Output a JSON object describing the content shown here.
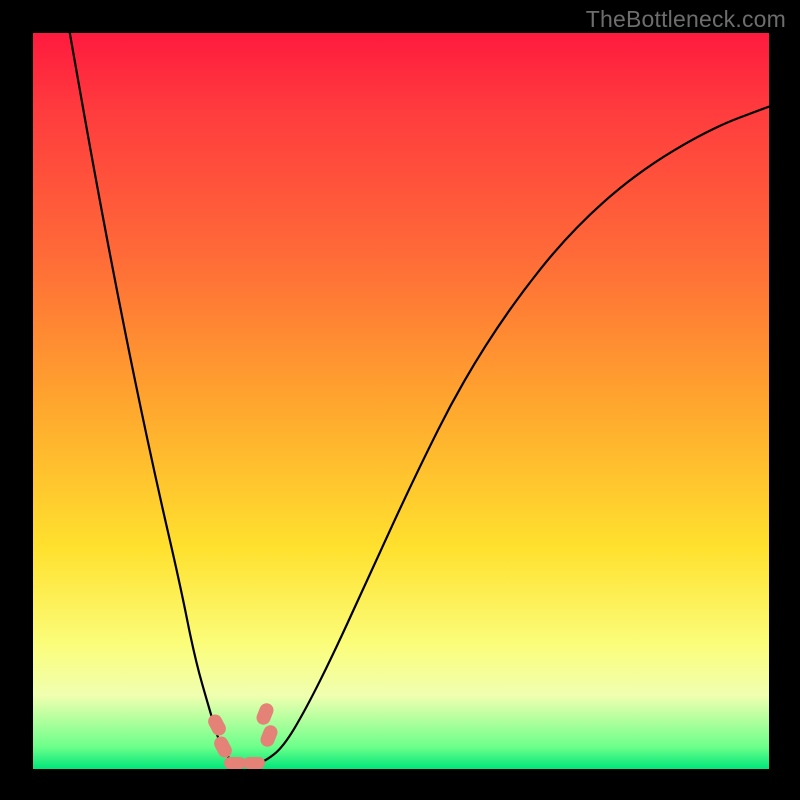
{
  "watermark": "TheBottleneck.com",
  "chart_data": {
    "type": "line",
    "title": "",
    "xlabel": "",
    "ylabel": "",
    "xlim": [
      0,
      100
    ],
    "ylim": [
      0,
      100
    ],
    "grid": false,
    "series": [
      {
        "name": "bottleneck-curve",
        "x": [
          5,
          8,
          11,
          14,
          17,
          20,
          22,
          24,
          25.5,
          27,
          28,
          29.5,
          31.5,
          34,
          37,
          41,
          46,
          52,
          58,
          65,
          73,
          82,
          92,
          100
        ],
        "y": [
          100,
          83,
          67,
          52,
          38,
          25,
          15,
          8,
          3,
          1,
          0.5,
          0.5,
          1,
          3,
          8,
          16,
          27,
          40,
          52,
          63,
          73,
          81,
          87,
          90
        ]
      }
    ],
    "annotations": [
      {
        "name": "marker-left-upper",
        "x": 25.0,
        "y": 6.0
      },
      {
        "name": "marker-left-lower",
        "x": 25.8,
        "y": 3.0
      },
      {
        "name": "marker-right-upper",
        "x": 31.5,
        "y": 7.5
      },
      {
        "name": "marker-right-lower",
        "x": 32.0,
        "y": 4.5
      },
      {
        "name": "marker-bottom-left",
        "x": 27.5,
        "y": 0.8
      },
      {
        "name": "marker-bottom-right",
        "x": 30.0,
        "y": 0.8
      }
    ]
  }
}
